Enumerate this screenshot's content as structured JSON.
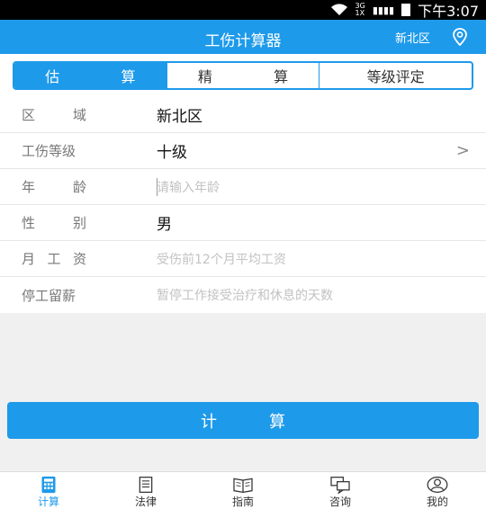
{
  "status": {
    "network": [
      "3G",
      "1X"
    ],
    "time": "下午3:07"
  },
  "header": {
    "title": "工伤计算器",
    "region": "新北区",
    "location_icon": "location-pin-icon"
  },
  "tabs": [
    {
      "label": [
        "估",
        "算"
      ],
      "active": true
    },
    {
      "label": [
        "精",
        "算"
      ],
      "active": false
    },
    {
      "label": [
        "等级评定"
      ],
      "active": false
    }
  ],
  "form": {
    "region": {
      "label": [
        "区",
        "域"
      ],
      "value": "新北区"
    },
    "injury_level": {
      "label": [
        "工伤等级"
      ],
      "value": "十级",
      "arrow": ">"
    },
    "age": {
      "label": [
        "年",
        "龄"
      ],
      "placeholder": "请输入年龄"
    },
    "gender": {
      "label": [
        "性",
        "别"
      ],
      "value": "男"
    },
    "salary": {
      "label": [
        "月",
        "工",
        "资"
      ],
      "placeholder": "受伤前12个月平均工资"
    },
    "leave": {
      "label": [
        "停工留薪"
      ],
      "placeholder": "暂停工作接受治疗和休息的天数"
    }
  },
  "calc_button": [
    "计",
    "算"
  ],
  "bottom_nav": [
    {
      "label": "计算",
      "icon": "calculator-icon",
      "active": true
    },
    {
      "label": "法律",
      "icon": "law-document-icon",
      "active": false
    },
    {
      "label": "指南",
      "icon": "guide-book-icon",
      "active": false
    },
    {
      "label": "咨询",
      "icon": "chat-icon",
      "active": false
    },
    {
      "label": "我的",
      "icon": "user-profile-icon",
      "active": false
    }
  ],
  "colors": {
    "primary": "#1e9aea"
  }
}
